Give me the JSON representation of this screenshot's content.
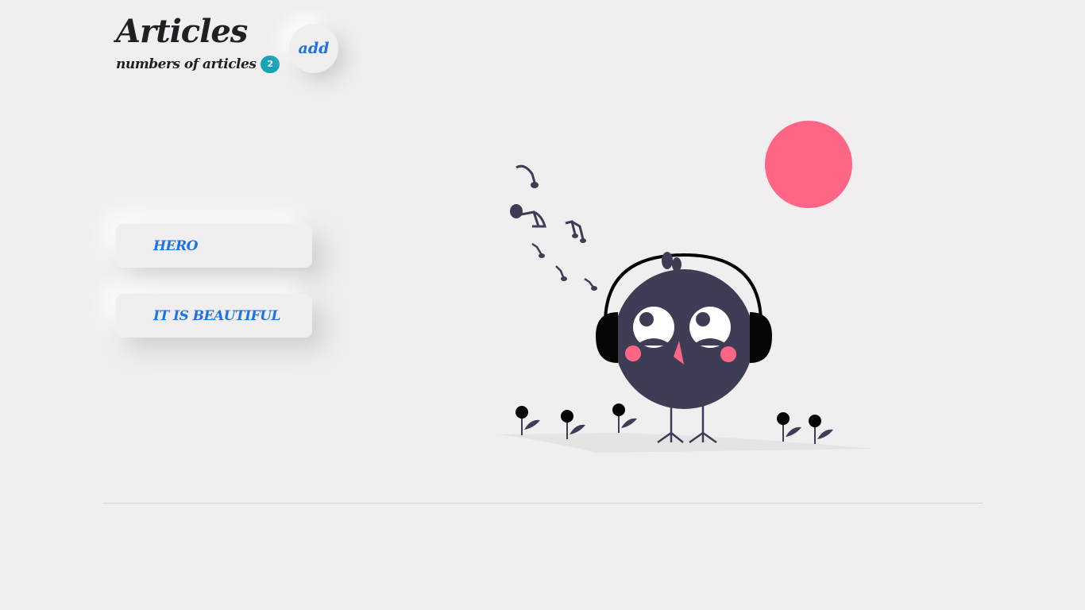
{
  "header": {
    "title": "Articles",
    "subtitle": "numbers of articles",
    "count": "2",
    "add_label": "add"
  },
  "articles": [
    {
      "title": "HERO"
    },
    {
      "title": "IT IS BEAUTIFUL"
    }
  ],
  "colors": {
    "accent": "#1a73e8",
    "badge": "#17a2b8",
    "sun": "#ff6584",
    "bird": "#3f3d56",
    "background": "#f0eeef"
  },
  "illustration": {
    "icon": "bird-with-headphones-icon"
  }
}
